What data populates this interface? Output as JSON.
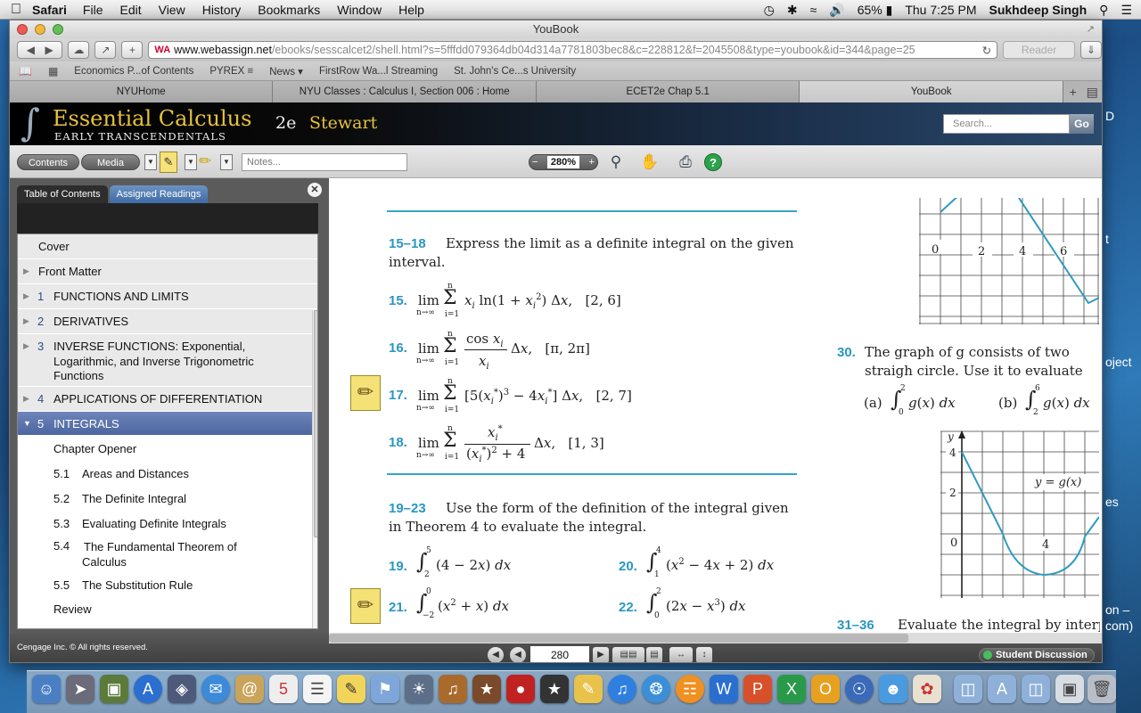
{
  "menubar": {
    "apple": "",
    "app": "Safari",
    "menus": [
      "File",
      "Edit",
      "View",
      "History",
      "Bookmarks",
      "Window",
      "Help"
    ],
    "battery": "65%",
    "clock": "Thu 7:25 PM",
    "user": "Sukhdeep Singh"
  },
  "window": {
    "title": "YouBook",
    "url_host": "www.webassign.net",
    "url_path": "/ebooks/sesscalcet2/shell.html?s=5fffdd079364db04d314a7781803bec8&c=228812&f=2045508&type=youbook&id=344&page=25",
    "reader_label": "Reader",
    "favicon": "WA"
  },
  "bookmarks": [
    "Economics P...of Contents",
    "PYREX ≡",
    "News ▾",
    "FirstRow Wa...l Streaming",
    "St. John's Ce...s University"
  ],
  "tabs": [
    "NYUHome",
    "NYU Classes : Calculus I, Section 006 : Home",
    "ECET2e Chap 5.1",
    "YouBook"
  ],
  "banner": {
    "title": "Essential Calculus",
    "subtitle": "EARLY TRANSCENDENTALS",
    "edition": "2e",
    "author": "Stewart",
    "search_placeholder": "Search...",
    "go_label": "Go"
  },
  "reader": {
    "contents_label": "Contents",
    "media_label": "Media",
    "notes_placeholder": "Notes...",
    "zoom": "280%"
  },
  "sidebar": {
    "tab_toc": "Table of Contents",
    "tab_assigned": "Assigned Readings",
    "items": [
      {
        "num": "",
        "label": "Cover",
        "arrow": ""
      },
      {
        "num": "",
        "label": "Front Matter",
        "arrow": "▶"
      },
      {
        "num": "1",
        "label": "FUNCTIONS AND LIMITS",
        "arrow": "▶"
      },
      {
        "num": "2",
        "label": "DERIVATIVES",
        "arrow": "▶"
      },
      {
        "num": "3",
        "label": "INVERSE FUNCTIONS: Exponential, Logarithmic, and Inverse Trigonometric Functions",
        "arrow": "▶"
      },
      {
        "num": "4",
        "label": "APPLICATIONS OF DIFFERENTIATION",
        "arrow": "▶"
      },
      {
        "num": "5",
        "label": "INTEGRALS",
        "arrow": "▼"
      }
    ],
    "subitems": [
      {
        "num": "",
        "label": "Chapter Opener"
      },
      {
        "num": "5.1",
        "label": "Areas and Distances"
      },
      {
        "num": "5.2",
        "label": "The Definite Integral"
      },
      {
        "num": "5.3",
        "label": "Evaluating Definite Integrals"
      },
      {
        "num": "5.4",
        "label": "The Fundamental Theorem of Calculus"
      },
      {
        "num": "5.5",
        "label": "The Substitution Rule"
      },
      {
        "num": "",
        "label": "Review"
      }
    ]
  },
  "content": {
    "range_15_18": "15–18",
    "instr_15_18": "Express the limit as a definite integral on the given interval.",
    "range_19_23": "19–23",
    "instr_19_23": "Use the form of the definition of the integral given in Theorem 4 to evaluate the integral.",
    "p15": "15.",
    "p16": "16.",
    "p17": "17.",
    "p18": "18.",
    "p19": "19.",
    "p20": "20.",
    "p21": "21.",
    "p22": "22.",
    "p30": "30.",
    "p30_text": "The graph of g consists of two straigh circle. Use it to evaluate each integral",
    "p30_a": "(a)",
    "p30_b": "(b)",
    "range_31_36": "31–36",
    "instr_31_36": "Evaluate the integral by interpret",
    "graph1_ticks": [
      "0",
      "2",
      "4",
      "6"
    ],
    "graph2_ticks": [
      "4",
      "2",
      "0",
      "4"
    ],
    "graph2_label": "y = g(x)",
    "graph2_axis": "y"
  },
  "bottom": {
    "copyright": "Cengage Inc. © All rights reserved.",
    "page": "280",
    "discussion": "Student Discussion"
  },
  "desktop": {
    "right_text_1": "D",
    "right_text_2": "t",
    "right_text_3": "oject",
    "right_text_4": "es",
    "right_text_5": "on –",
    "right_text_6": "com)"
  }
}
